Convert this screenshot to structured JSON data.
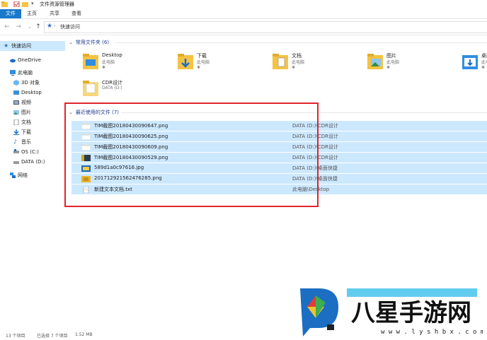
{
  "window": {
    "title": "文件资源管理器",
    "quick_icons": [
      "folder-icon",
      "properties-icon",
      "new-folder-icon",
      "dropdown-icon"
    ]
  },
  "ribbon": {
    "tabs": [
      "文件",
      "主页",
      "共享",
      "查看"
    ]
  },
  "address": {
    "path": "快速访问"
  },
  "sidebar": {
    "items": [
      {
        "label": "快速访问",
        "icon": "star-icon",
        "selected": true
      },
      {
        "label": "OneDrive",
        "icon": "cloud-icon"
      },
      {
        "label": "此电脑",
        "icon": "computer-icon"
      },
      {
        "label": "3D 对象",
        "icon": "3d-objects-icon"
      },
      {
        "label": "Desktop",
        "icon": "desktop-icon"
      },
      {
        "label": "视频",
        "icon": "video-icon"
      },
      {
        "label": "图片",
        "icon": "picture-icon"
      },
      {
        "label": "文档",
        "icon": "document-icon"
      },
      {
        "label": "下载",
        "icon": "download-icon"
      },
      {
        "label": "音乐",
        "icon": "music-icon"
      },
      {
        "label": "OS (C:)",
        "icon": "drive-icon"
      },
      {
        "label": "DATA (D:)",
        "icon": "drive-icon"
      },
      {
        "label": "网络",
        "icon": "network-icon"
      }
    ]
  },
  "frequent": {
    "header": "常用文件夹 (6)",
    "folders": [
      {
        "name": "Desktop",
        "sub": "此电脑",
        "pin": "✱"
      },
      {
        "name": "下载",
        "sub": "此电脑",
        "pin": "✱"
      },
      {
        "name": "文档",
        "sub": "此电脑",
        "pin": "✱"
      },
      {
        "name": "图片",
        "sub": "此电脑",
        "pin": "✱"
      },
      {
        "name": "桌面",
        "sub": "此电脑",
        "pin": "✱"
      },
      {
        "name": "CDR设计",
        "sub": "DATA (D:)",
        "pin": ""
      }
    ]
  },
  "recent": {
    "header": "最近使用的文件 (7)",
    "files": [
      {
        "name": "TIM截图20180430090647.png",
        "location": "DATA (D:)\\CDR设计",
        "icon": "png-screenshot-icon"
      },
      {
        "name": "TIM截图20180430090625.png",
        "location": "DATA (D:)\\CDR设计",
        "icon": "png-screenshot-icon"
      },
      {
        "name": "TIM截图20180430090609.png",
        "location": "DATA (D:)\\CDR设计",
        "icon": "png-screenshot-icon"
      },
      {
        "name": "TIM截图20180430090529.png",
        "location": "DATA (D:)\\CDR设计",
        "icon": "png-dark-icon"
      },
      {
        "name": "589d1a0c97616.jpg",
        "location": "DATA (D:)\\桌面快捷",
        "icon": "jpg-image-icon"
      },
      {
        "name": "2017129215624762​85.png",
        "location": "DATA (D:)\\桌面快捷",
        "icon": "png-yellow-icon"
      },
      {
        "name": "新建文本文档.txt",
        "location": "此电脑\\Desktop",
        "icon": "txt-file-icon"
      }
    ]
  },
  "status": {
    "count": "13 个项目",
    "selected": "已选择 7 个项目",
    "size": "1.52 MB"
  },
  "colors": {
    "accent": "#1979ca",
    "selection": "#cce8ff",
    "highlight_box": "#e0242a",
    "folder": "#f5c343"
  }
}
